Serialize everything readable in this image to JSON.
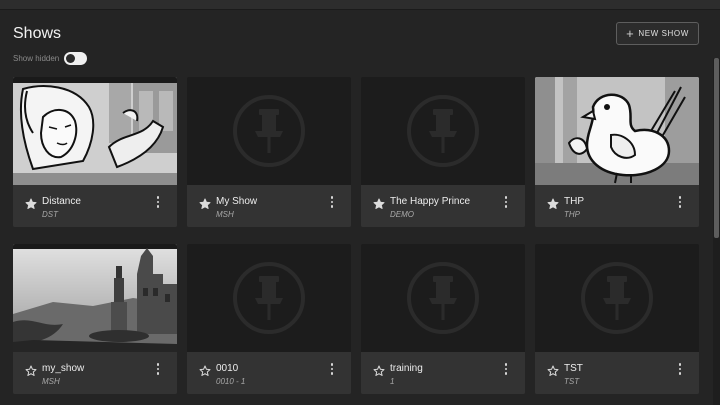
{
  "header": {
    "title": "Shows",
    "show_hidden_label": "Show hidden",
    "show_hidden_on": true,
    "new_show_label": "NEW SHOW"
  },
  "shows": [
    {
      "name": "Distance",
      "code": "DST",
      "favorite": true,
      "thumbnail": "sketch-girl"
    },
    {
      "name": "My Show",
      "code": "MSH",
      "favorite": true,
      "thumbnail": "pin-icon"
    },
    {
      "name": "The Happy Prince",
      "code": "DEMO",
      "favorite": true,
      "thumbnail": "pin-icon"
    },
    {
      "name": "THP",
      "code": "THP",
      "favorite": true,
      "thumbnail": "sketch-bird"
    },
    {
      "name": "my_show",
      "code": "MSH",
      "favorite": false,
      "thumbnail": "statue-plaza"
    },
    {
      "name": "0010",
      "code": "0010 - 1",
      "favorite": false,
      "thumbnail": "pin-icon"
    },
    {
      "name": "training",
      "code": "1",
      "favorite": false,
      "thumbnail": "pin-icon"
    },
    {
      "name": "TST",
      "code": "TST",
      "favorite": false,
      "thumbnail": "pin-icon"
    }
  ],
  "colors": {
    "background": "#242424",
    "card": "#333333",
    "placeholder": "#1c1c1c",
    "accent_text": "#ededed"
  }
}
